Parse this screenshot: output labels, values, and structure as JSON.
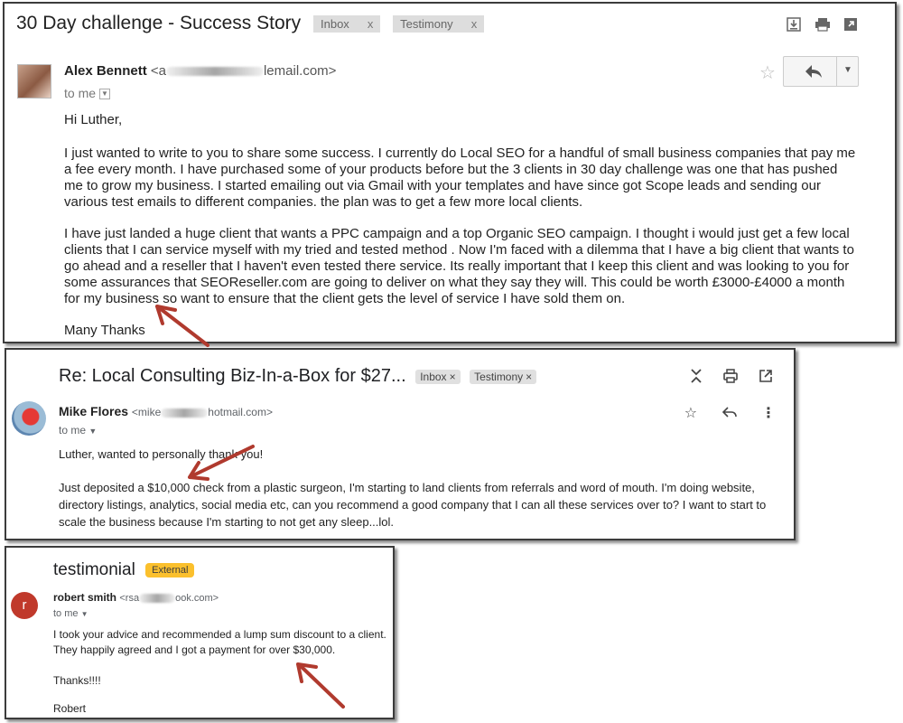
{
  "email1": {
    "subject": "30 Day challenge - Success Story",
    "labels": [
      "Inbox",
      "Testimony"
    ],
    "label_close": "x",
    "sender_name": "Alex Bennett",
    "sender_email_prefix": "<a",
    "sender_email_suffix": "lemail.com>",
    "to_me": "to me",
    "greeting": "Hi Luther,",
    "paragraph1": "I just wanted to write to you to share some success. I currently do Local SEO for a handful of small business companies that pay me a fee every month. I have purchased some of your products before but the 3 clients in 30 day challenge was one that has pushed me to grow my business. I started emailing out via Gmail with your templates and have since got Scope leads and sending our various test emails to different companies. the plan was to get a few more local clients.",
    "paragraph2": "I have just landed a huge client that wants a PPC campaign and a top Organic SEO campaign. I thought i would just get a few local clients that I can service myself with my tried and tested method . Now I'm faced with a dilemma that I have a big client that wants to go ahead and a reseller that I haven't even tested there service. Its really important that I keep this client and was looking to you for some assurances that SEOReseller.com are going to deliver on what they say they will. This could be worth £3000-£4000 a month for my business so want to ensure that the client gets the level of service I have sold them on.",
    "closing": "Many Thanks"
  },
  "email2": {
    "subject": "Re: Local Consulting Biz-In-a-Box for $27...",
    "labels": [
      "Inbox",
      "Testimony"
    ],
    "label_close": "×",
    "sender_name": "Mike Flores",
    "sender_email_prefix": "<mike",
    "sender_email_suffix": "hotmail.com>",
    "to_me": "to me",
    "line1": "Luther, wanted to personally thank you!",
    "paragraph": "Just deposited a $10,000 check from a plastic surgeon, I'm starting to land clients from referrals and word of mouth. I'm doing website, directory listings, analytics, social media etc, can you recommend a good company that I can all these services over to? I want to start to scale the business because I'm starting to not get any sleep...lol."
  },
  "email3": {
    "subject": "testimonial",
    "badge": "External",
    "avatar_letter": "r",
    "sender_name": "robert smith",
    "sender_email_prefix": "<rsa",
    "sender_email_suffix": "ook.com>",
    "to_me": "to me",
    "line1": "I took your advice and recommended a lump sum discount to a client.",
    "line2": "They happily agreed and I got a payment for over $30,000.",
    "thanks": "Thanks!!!!",
    "signature": "Robert"
  },
  "icons": {
    "download": "download-icon",
    "print": "print-icon",
    "popout": "open-in-new-icon",
    "star": "star-icon",
    "reply": "reply-icon",
    "more": "more-vert-icon",
    "collapse": "collapse-icon",
    "dropdown": "chevron-down-icon"
  },
  "colors": {
    "annotation_arrow": "#b03a2e",
    "external_badge": "#fbc02d",
    "avatar_r": "#c0392b"
  }
}
